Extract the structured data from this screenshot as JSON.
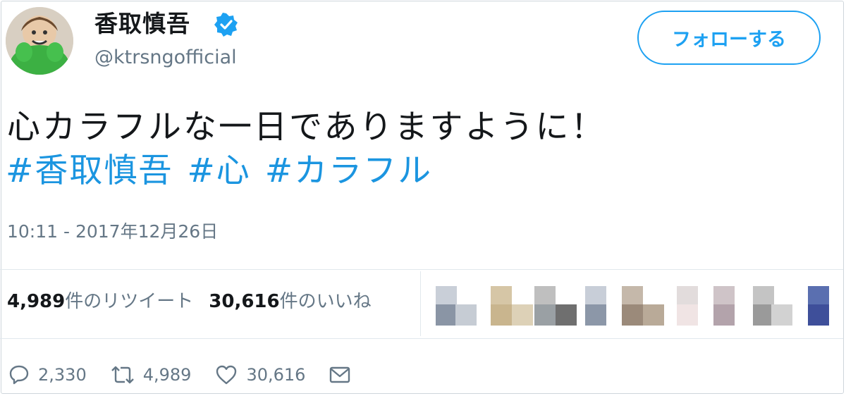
{
  "author": {
    "name": "香取慎吾",
    "handle": "@ktrsngofficial",
    "verified_icon": "verified-badge-icon"
  },
  "follow_button": {
    "label": "フォローする"
  },
  "tweet": {
    "text": "心カラフルな一日でありますように！",
    "hashtags": [
      "#香取慎吾",
      "#心",
      "#カラフル"
    ],
    "timestamp": "10:11 - 2017年12月26日"
  },
  "stats": {
    "retweets_count": "4,989",
    "retweets_label": "件のリツイート",
    "likes_count": "30,616",
    "likes_label": "件のいいね"
  },
  "actions": {
    "reply_count": "2,330",
    "retweet_count": "4,989",
    "like_count": "30,616"
  },
  "colors": {
    "accent": "#1da1f2",
    "hashtag": "#1b95e0",
    "muted": "#657786",
    "border": "#e1e8ed"
  }
}
